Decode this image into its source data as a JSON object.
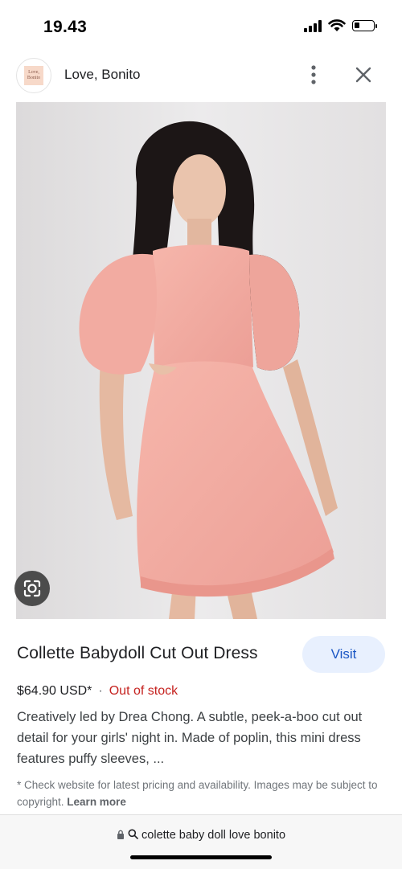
{
  "status_bar": {
    "time": "19.43",
    "icons": [
      "signal-icon",
      "wifi-icon",
      "battery-icon"
    ]
  },
  "header": {
    "site_name": "Love, Bonito",
    "favicon_text": "Love, Bonito",
    "more_icon": "more-vert-icon",
    "close_icon": "close-icon"
  },
  "image": {
    "lens_icon": "lens-search-icon",
    "dress_color": "#f2a8a0",
    "background_color": "#e8e6e7"
  },
  "product": {
    "title": "Collette Babydoll Cut Out Dress",
    "visit_label": "Visit",
    "price": "$64.90 USD*",
    "separator": "·",
    "stock_status": "Out of stock",
    "description": "Creatively led by Drea Chong. A subtle, peek-a-boo cut out detail for your girls' night in. Made of poplin, this mini dress features puffy sleeves, ...",
    "disclaimer": "* Check website for latest pricing and availability. Images may be subject to copyright.",
    "learn_more": "Learn more"
  },
  "url_bar": {
    "url": "colette baby doll love bonito",
    "icons": [
      "lock-icon",
      "search-icon"
    ]
  },
  "colors": {
    "accent": "#1a56c4",
    "visit_bg": "#e8f0fe",
    "out_of_stock": "#c5221f"
  }
}
